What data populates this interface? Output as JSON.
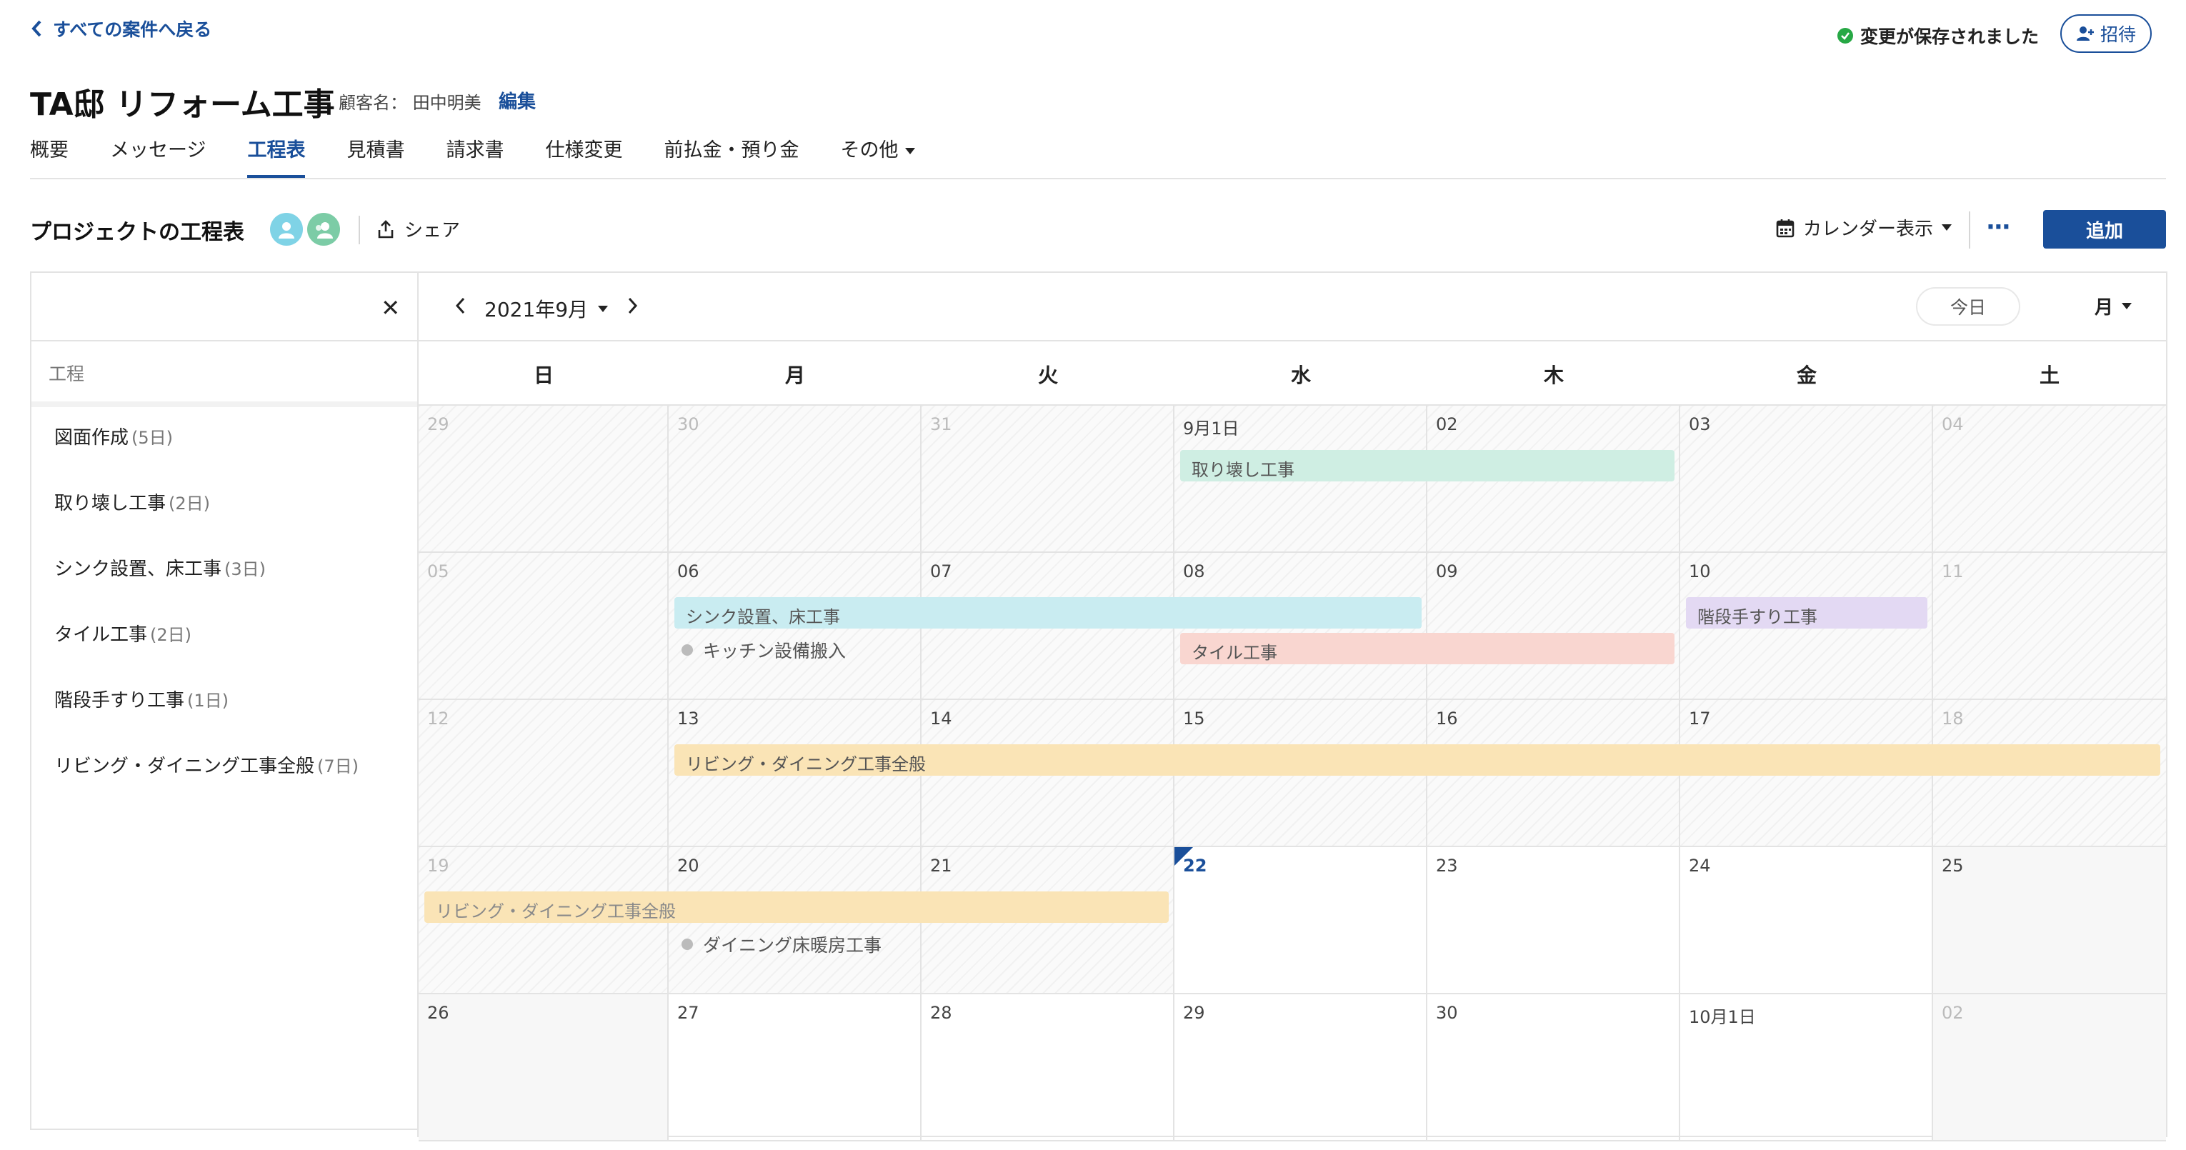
{
  "header": {
    "back_label": "すべての案件へ戻る",
    "saved_status": "変更が保存されました",
    "invite_label": "招待",
    "project_title": "TA邸 リフォーム工事",
    "customer_label": "顧客名： 田中明美",
    "edit_label": "編集"
  },
  "tabs": [
    {
      "label": "概要"
    },
    {
      "label": "メッセージ"
    },
    {
      "label": "工程表",
      "active": true
    },
    {
      "label": "見積書"
    },
    {
      "label": "請求書"
    },
    {
      "label": "仕様変更"
    },
    {
      "label": "前払金・預り金"
    },
    {
      "label": "その他"
    }
  ],
  "toolbar": {
    "section_title": "プロジェクトの工程表",
    "share_label": "シェア",
    "view_label": "カレンダー表示",
    "more_label": "···",
    "add_label": "追加"
  },
  "left_panel": {
    "header": "工程",
    "close_icon": "close-icon",
    "tasks": [
      {
        "name": "図面作成",
        "duration": "(5日)"
      },
      {
        "name": "取り壊し工事",
        "duration": "(2日)"
      },
      {
        "name": "シンク設置、床工事",
        "duration": "(3日)"
      },
      {
        "name": "タイル工事",
        "duration": "(2日)"
      },
      {
        "name": "階段手すり工事",
        "duration": "(1日)"
      },
      {
        "name": "リビング・ダイニング工事全般",
        "duration": "(7日)"
      }
    ]
  },
  "calendar": {
    "month_label": "2021年9月",
    "today_label": "今日",
    "range_label": "月",
    "weekdays": [
      "日",
      "月",
      "火",
      "水",
      "木",
      "金",
      "土"
    ],
    "weeks": [
      [
        {
          "n": "29",
          "s": "other",
          "p": 1
        },
        {
          "n": "30",
          "s": "other",
          "p": 1
        },
        {
          "n": "31",
          "s": "other",
          "p": 1
        },
        {
          "n": "9月1日",
          "s": "cur",
          "p": 1
        },
        {
          "n": "02",
          "s": "cur",
          "p": 1
        },
        {
          "n": "03",
          "s": "cur",
          "p": 1
        },
        {
          "n": "04",
          "s": "other",
          "p": 1
        }
      ],
      [
        {
          "n": "05",
          "s": "other",
          "p": 1
        },
        {
          "n": "06",
          "s": "cur",
          "p": 1
        },
        {
          "n": "07",
          "s": "cur",
          "p": 1
        },
        {
          "n": "08",
          "s": "cur",
          "p": 1
        },
        {
          "n": "09",
          "s": "cur",
          "p": 1
        },
        {
          "n": "10",
          "s": "cur",
          "p": 1
        },
        {
          "n": "11",
          "s": "other",
          "p": 1
        }
      ],
      [
        {
          "n": "12",
          "s": "other",
          "p": 1
        },
        {
          "n": "13",
          "s": "cur",
          "p": 1
        },
        {
          "n": "14",
          "s": "cur",
          "p": 1
        },
        {
          "n": "15",
          "s": "cur",
          "p": 1
        },
        {
          "n": "16",
          "s": "cur",
          "p": 1
        },
        {
          "n": "17",
          "s": "cur",
          "p": 1
        },
        {
          "n": "18",
          "s": "other",
          "p": 1
        }
      ],
      [
        {
          "n": "19",
          "s": "other",
          "p": 1
        },
        {
          "n": "20",
          "s": "cur",
          "p": 1
        },
        {
          "n": "21",
          "s": "cur",
          "p": 1
        },
        {
          "n": "22",
          "s": "today",
          "p": 0
        },
        {
          "n": "23",
          "s": "cur",
          "p": 0
        },
        {
          "n": "24",
          "s": "cur",
          "p": 0
        },
        {
          "n": "25",
          "s": "cur",
          "p": 0,
          "w": 1
        }
      ],
      [
        {
          "n": "26",
          "s": "cur",
          "p": 0,
          "w": 1
        },
        {
          "n": "27",
          "s": "cur",
          "p": 0
        },
        {
          "n": "28",
          "s": "cur",
          "p": 0
        },
        {
          "n": "29",
          "s": "cur",
          "p": 0
        },
        {
          "n": "30",
          "s": "cur",
          "p": 0
        },
        {
          "n": "10月1日",
          "s": "cur",
          "p": 0
        },
        {
          "n": "02",
          "s": "other",
          "p": 0,
          "w": 1
        }
      ]
    ],
    "events": [
      {
        "label": "取り壊し工事",
        "week": 0,
        "start": 3,
        "span": 2,
        "lane": 0,
        "color": "green"
      },
      {
        "label": "シンク設置、床工事",
        "week": 1,
        "start": 1,
        "span": 3,
        "lane": 0,
        "color": "cyan"
      },
      {
        "label": "階段手すり工事",
        "week": 1,
        "start": 5,
        "span": 1,
        "lane": 0,
        "color": "purple"
      },
      {
        "label": "タイル工事",
        "week": 1,
        "start": 3,
        "span": 2,
        "lane": 1,
        "color": "red"
      },
      {
        "label": "リビング・ダイニング工事全般",
        "week": 2,
        "start": 1,
        "span": 6,
        "lane": 0,
        "color": "yellow"
      },
      {
        "label": "リビング・ダイニング工事全般",
        "week": 3,
        "start": 0,
        "span": 3,
        "lane": 0,
        "color": "yellow",
        "faded": true
      }
    ],
    "milestones": [
      {
        "label": "キッチン設備搬入",
        "week": 1,
        "day": 1,
        "lane": 1
      },
      {
        "label": "ダイニング床暖房工事",
        "week": 3,
        "day": 1,
        "lane": 1
      }
    ]
  }
}
